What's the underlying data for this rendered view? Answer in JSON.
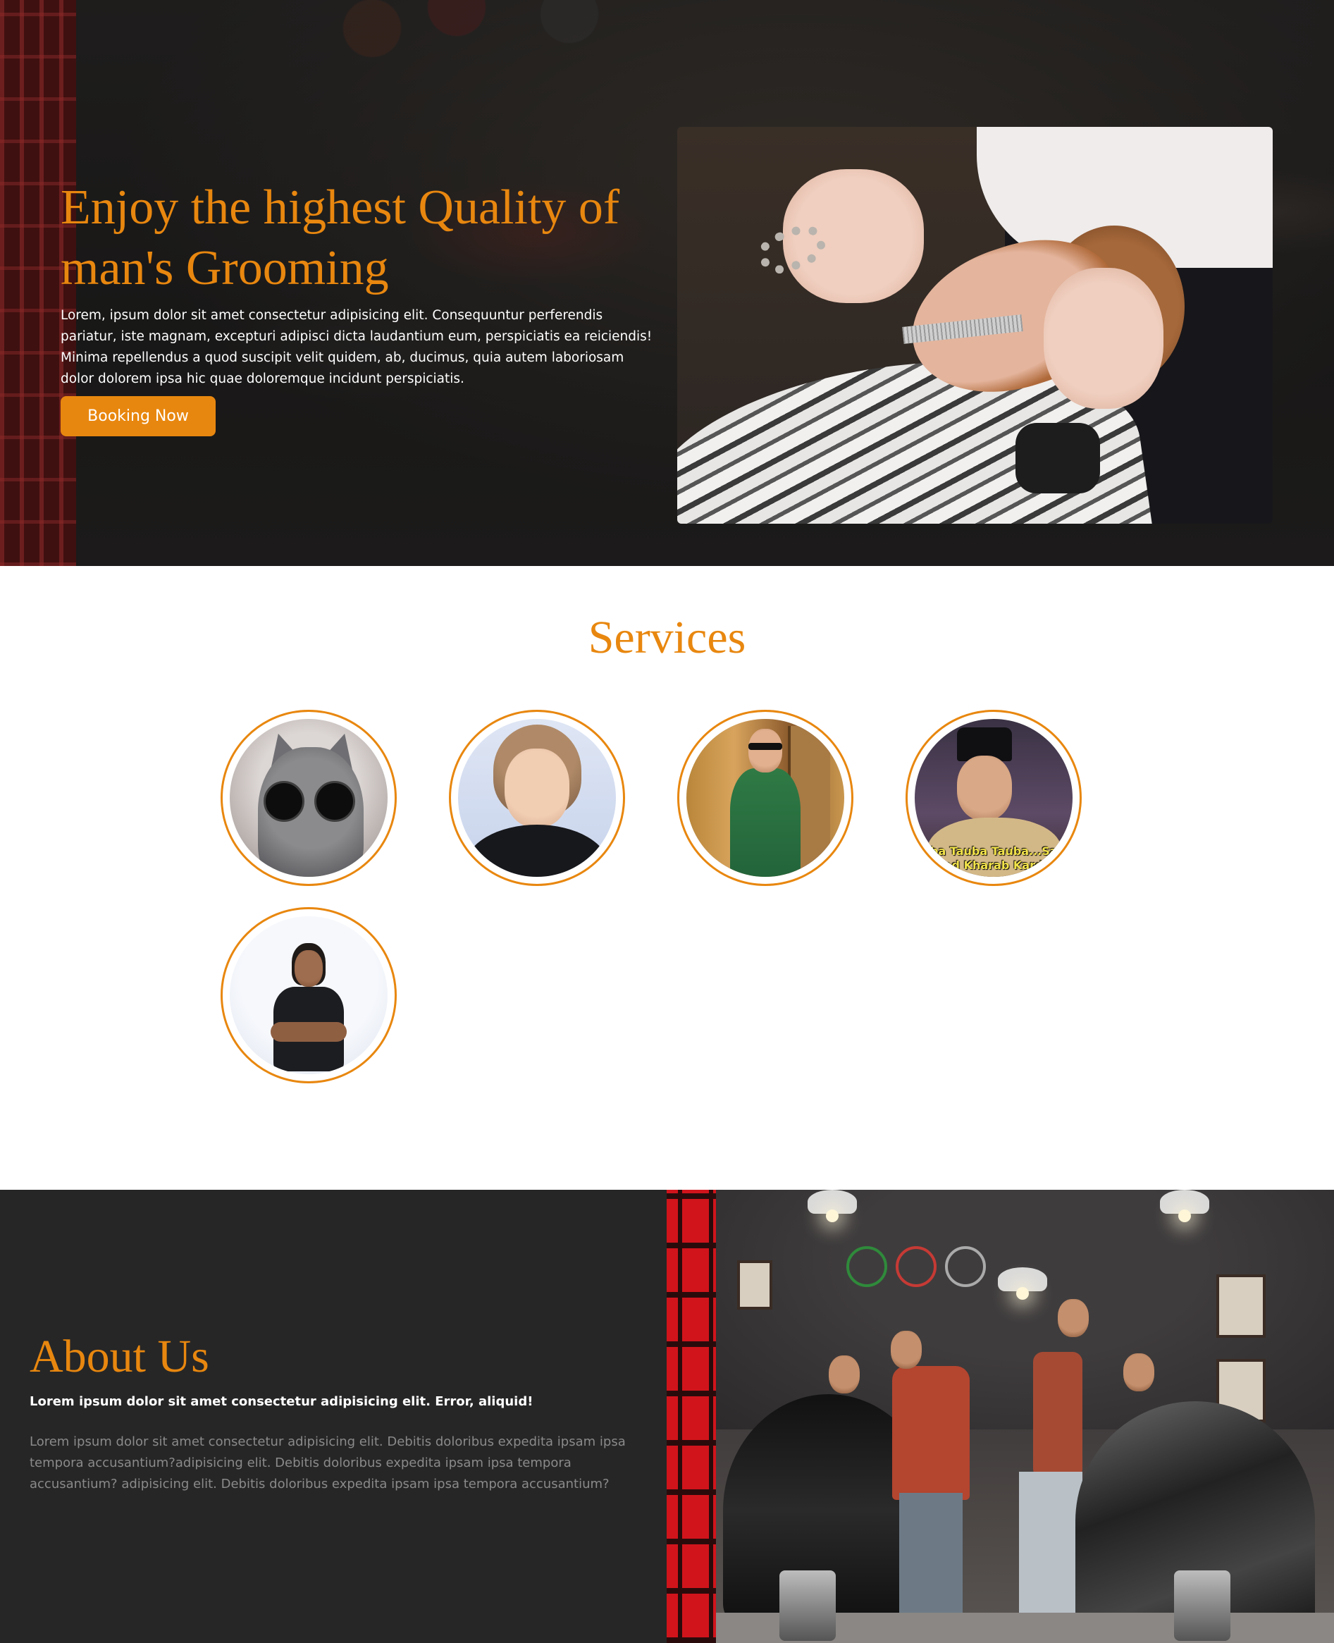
{
  "hero": {
    "title": "Enjoy the highest Quality of man's Grooming",
    "text": "Lorem, ipsum dolor sit amet consectetur adipisicing elit. Consequuntur perferendis pariatur, iste magnam, excepturi adipisci dicta laudantium eum, perspiciatis ea reiciendis! Minima repellendus a quod suscipit velit quidem, ab, ducimus, quia autem laboriosam dolor dolorem ipsa hic quae doloremque incidunt perspiciatis.",
    "button_label": "Booking Now"
  },
  "services": {
    "title": "Services",
    "items": [
      {
        "name": "service-cat"
      },
      {
        "name": "service-v"
      },
      {
        "name": "service-green-suit"
      },
      {
        "name": "service-meme",
        "caption_line1": "uba Tauba Tauba...Saa",
        "caption_line2": "od Kharab Kard"
      },
      {
        "name": "service-man-arms-crossed"
      }
    ]
  },
  "about": {
    "title": "About Us",
    "lead": "Lorem ipsum dolor sit amet consectetur adipisicing elit. Error, aliquid!",
    "text": "Lorem ipsum dolor sit amet consectetur adipisicing elit. Debitis doloribus expedita ipsam ipsa tempora accusantium?adipisicing elit. Debitis doloribus expedita ipsam ipsa tempora accusantium? adipisicing elit. Debitis doloribus expedita ipsam ipsa tempora accusantium?"
  },
  "colors": {
    "accent": "#e8870f",
    "dark_bg": "#262626",
    "muted_text": "#8a8a8a"
  }
}
